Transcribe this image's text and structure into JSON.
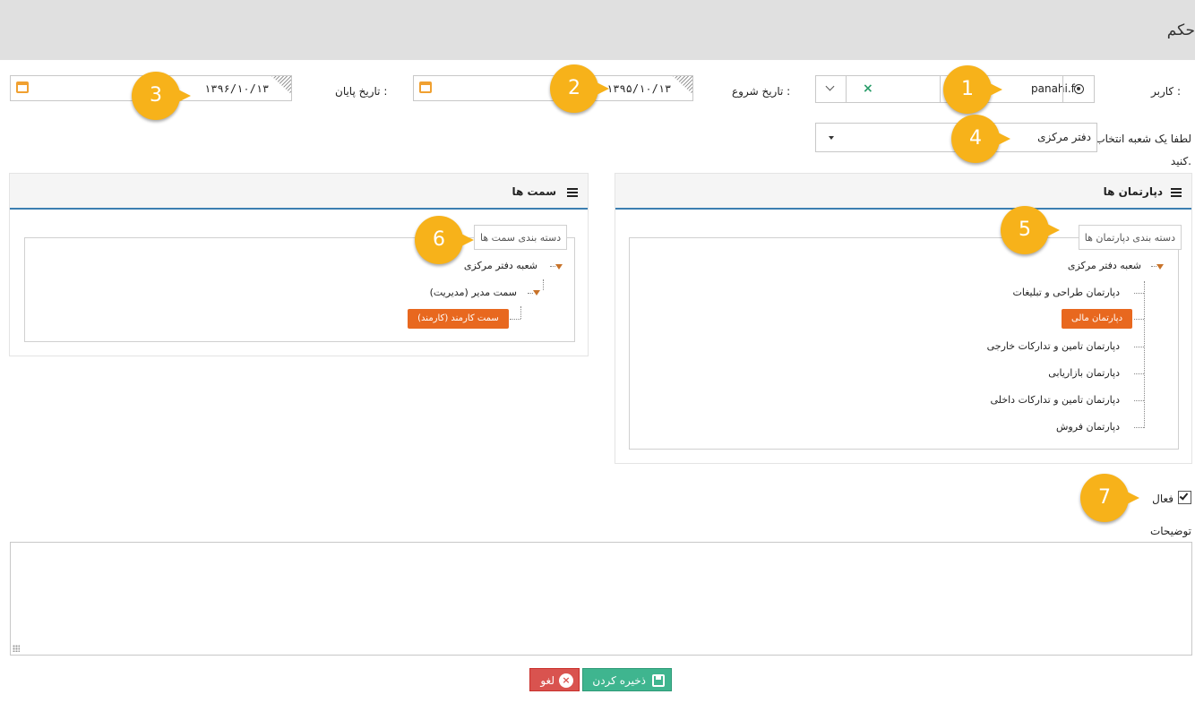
{
  "page": {
    "title": "حکم"
  },
  "user": {
    "label": "کاربر :",
    "value": "panahi.f",
    "clear_icon": "close-icon",
    "pick_icon": "radio-target-icon",
    "dropdown_icon": "chevron-down-icon"
  },
  "start_date": {
    "label": "تاریخ شروع :",
    "value": "۱۳۹۵/۱۰/۱۳",
    "icon": "calendar-icon"
  },
  "end_date": {
    "label": "تاریخ پایان :",
    "value": "۱۳۹۶/۱۰/۱۳",
    "icon": "calendar-icon"
  },
  "branch": {
    "label_line1": "لطفا یک شعبه انتخاب",
    "label_line2": "کنید.",
    "value": "دفتر مرکزی"
  },
  "departments_panel": {
    "title": "دپارتمان ها",
    "legend": "دسته بندی دپارتمان ها",
    "root": "شعبه دفتر مرکزی",
    "items": [
      {
        "label": "دپارتمان طراحی و تبلیغات",
        "selected": false
      },
      {
        "label": "دپارتمان مالی",
        "selected": true
      },
      {
        "label": "دپارتمان تامین و تدارکات خارجی",
        "selected": false
      },
      {
        "label": "دپارتمان بازاریابی",
        "selected": false
      },
      {
        "label": "دپارتمان تامین و تدارکات داخلی",
        "selected": false
      },
      {
        "label": "دپارتمان فروش",
        "selected": false
      }
    ]
  },
  "positions_panel": {
    "title": "سمت ها",
    "legend": "دسته بندی سمت ها",
    "root": "شعبه دفتر مرکزی",
    "child": "سمت مدیر (مدیریت)",
    "leaf": "سمت کارمند (کارمند)"
  },
  "active": {
    "label": "فعال",
    "checked": true
  },
  "description": {
    "label": "توضیحات",
    "value": ""
  },
  "buttons": {
    "save": "ذخیره کردن",
    "cancel": "لغو"
  },
  "callouts": [
    "1",
    "2",
    "3",
    "4",
    "5",
    "6",
    "7"
  ],
  "colors": {
    "accent_orange": "#e8681f",
    "save_green": "#3fb58f",
    "cancel_red": "#d9534f",
    "callout_yellow": "#f7b21a",
    "panel_border_blue": "#3c7fb1"
  }
}
